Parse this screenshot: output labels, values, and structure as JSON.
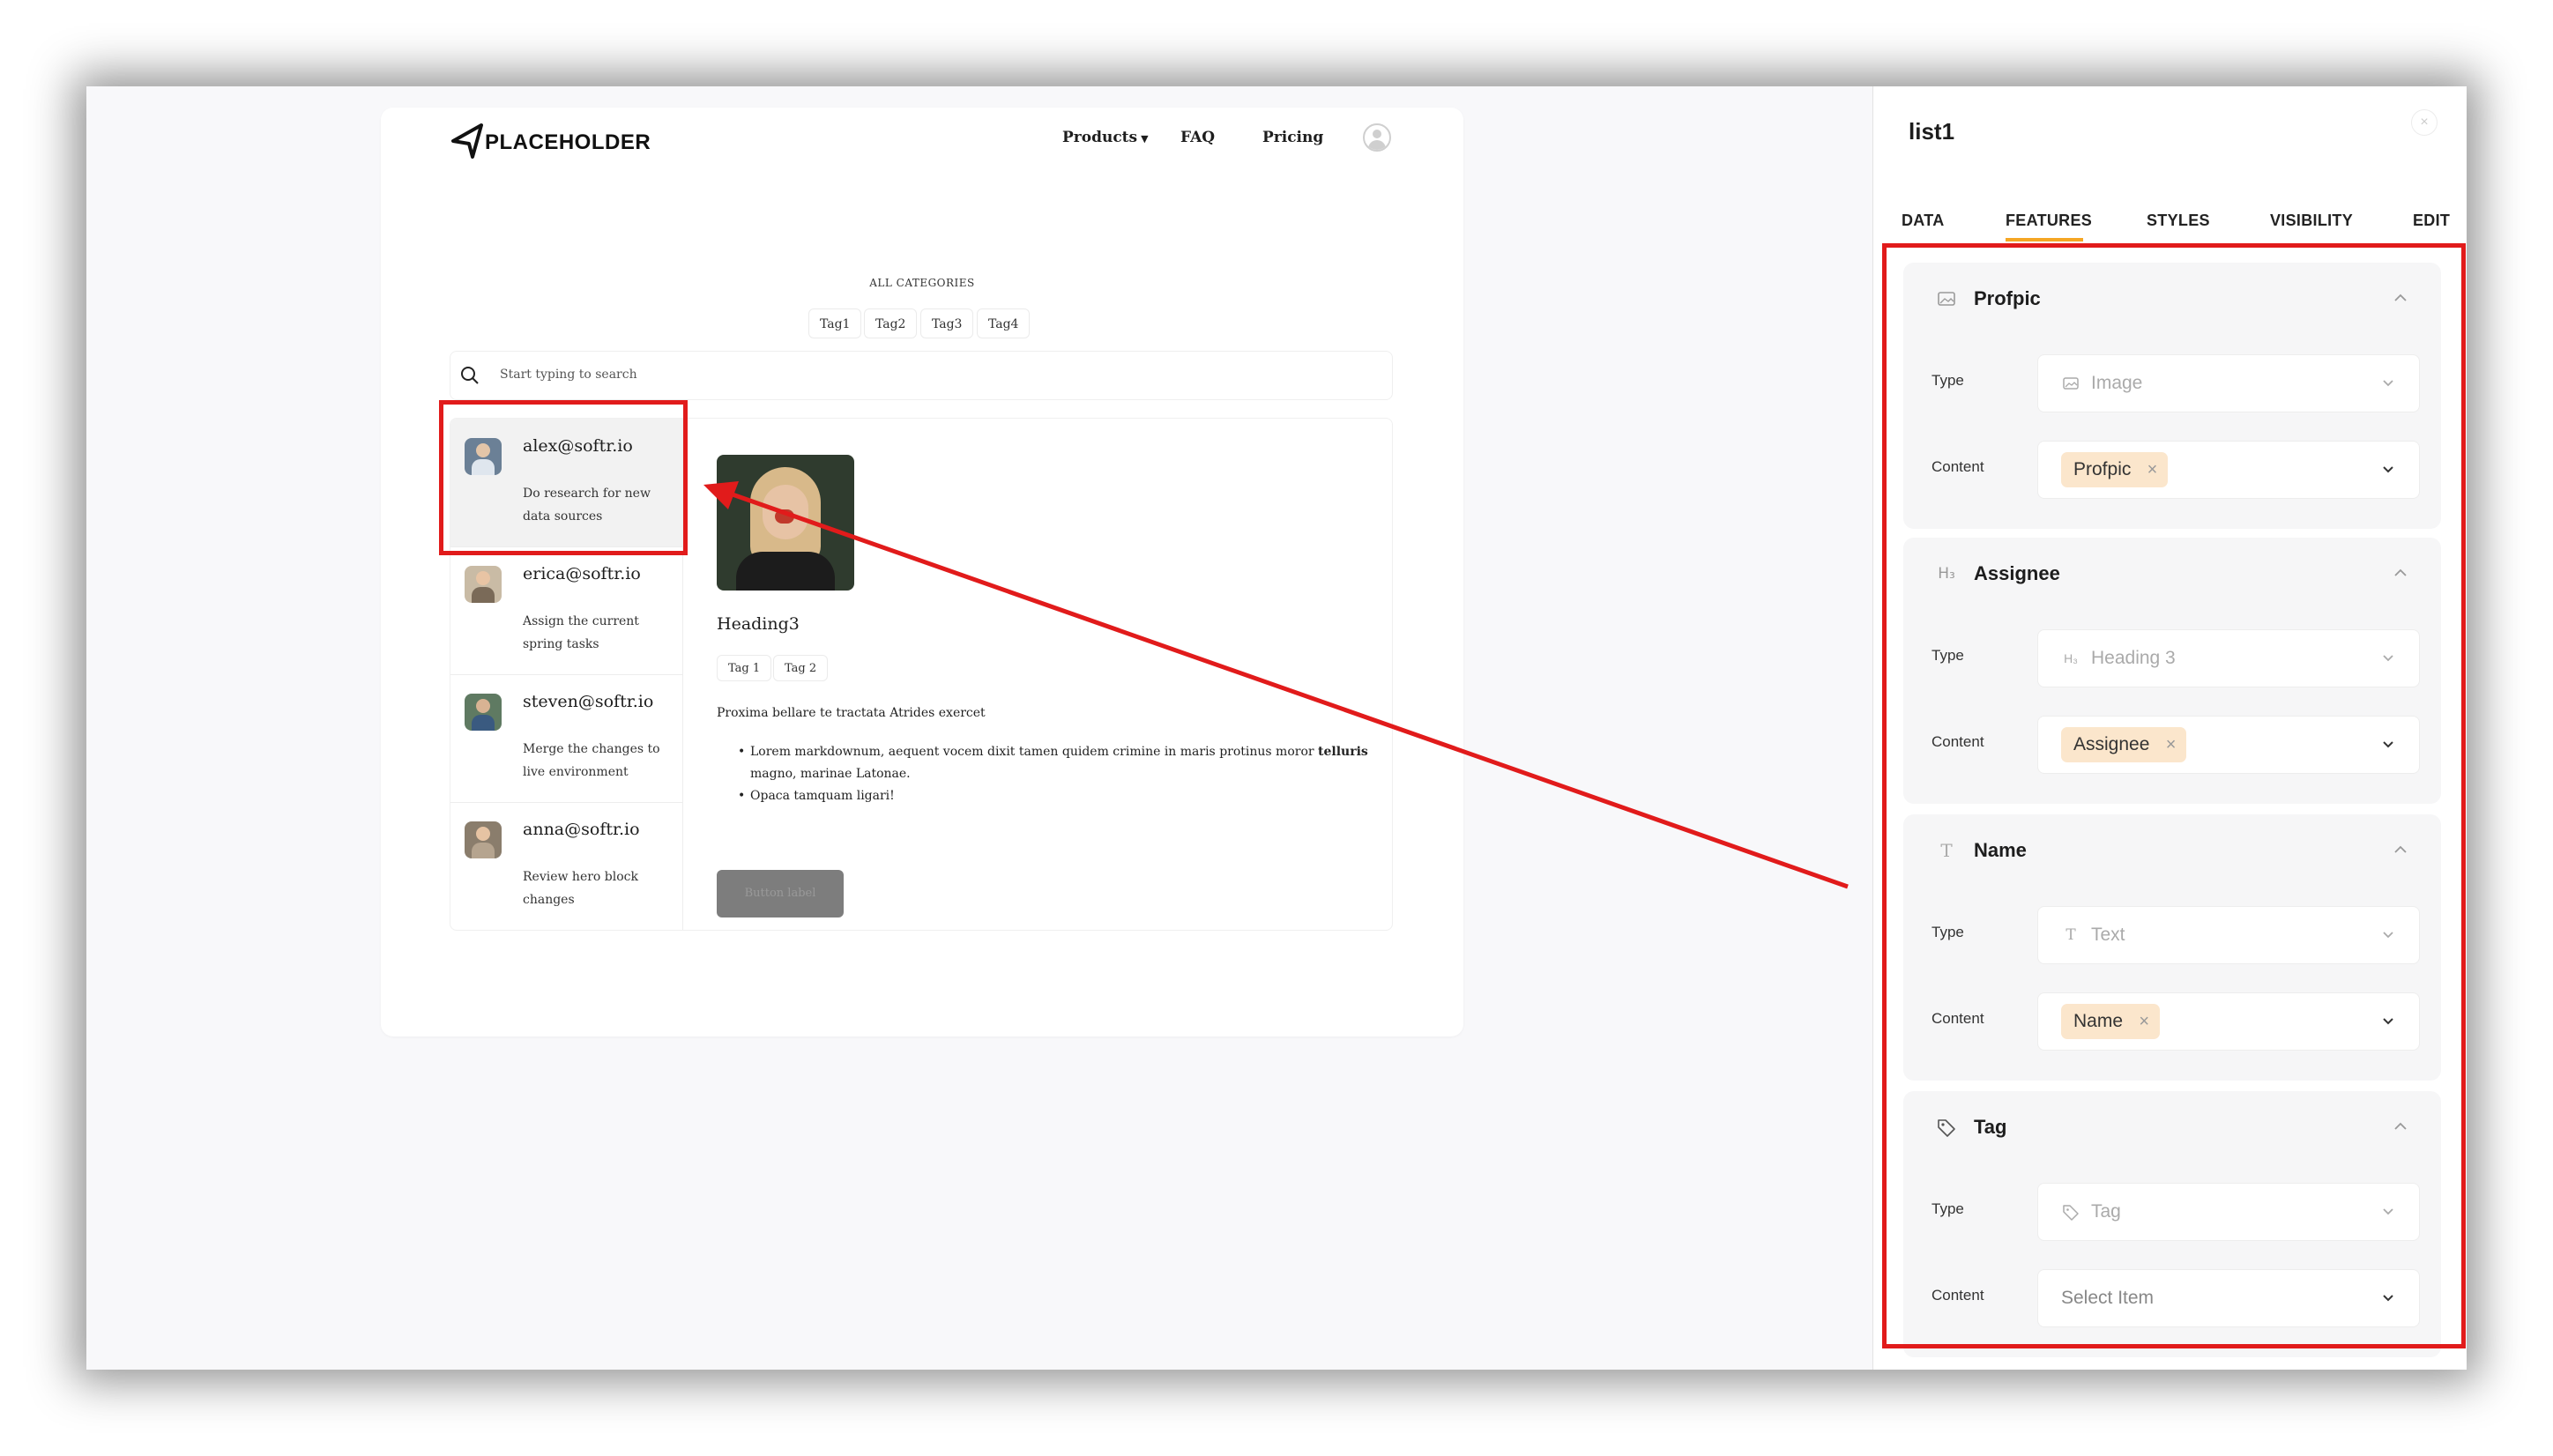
{
  "preview": {
    "logo_text": "PLACEHOLDER",
    "nav": [
      "Products",
      "FAQ",
      "Pricing"
    ],
    "categories_label": "ALL CATEGORIES",
    "tags": [
      "Tag1",
      "Tag2",
      "Tag3",
      "Tag4"
    ],
    "search_placeholder": "Start typing to search",
    "list_items": [
      {
        "title": "alex@softr.io",
        "desc": "Do research for new data sources"
      },
      {
        "title": "erica@softr.io",
        "desc": "Assign the current spring tasks"
      },
      {
        "title": "steven@softr.io",
        "desc": "Merge the changes to live environment"
      },
      {
        "title": "anna@softr.io",
        "desc": "Review hero block changes"
      }
    ],
    "detail": {
      "heading": "Heading3",
      "tags": [
        "Tag 1",
        "Tag 2"
      ],
      "paragraph": "Proxima bellare te tractata Atrides exercet",
      "bullet1_text": "Lorem markdownum, aequent vocem dixit tamen quidem crimine in maris protinus moror ",
      "bullet1_bold": "telluris",
      "bullet1_cont": "magno, marinae Latonae.",
      "bullet2": "Opaca tamquam ligari!",
      "button_label": "Button label"
    }
  },
  "panel": {
    "title": "list1",
    "tabs": [
      "DATA",
      "FEATURES",
      "STYLES",
      "VISIBILITY",
      "EDIT"
    ],
    "active_tab": "FEATURES",
    "type_label": "Type",
    "content_label": "Content",
    "sections": [
      {
        "title": "Profpic",
        "icon": "image-icon",
        "type_value": "Image",
        "content_chip": "Profpic"
      },
      {
        "title": "Assignee",
        "icon": "heading3-icon",
        "type_value": "Heading 3",
        "content_chip": "Assignee"
      },
      {
        "title": "Name",
        "icon": "text-icon",
        "type_value": "Text",
        "content_chip": "Name"
      },
      {
        "title": "Tag",
        "icon": "tag-icon",
        "type_value": "Tag",
        "content_placeholder": "Select Item"
      }
    ]
  },
  "colors": {
    "accent": "#f5a623",
    "annotation": "#e11b1b",
    "chip_bg": "#fbe6cc"
  }
}
